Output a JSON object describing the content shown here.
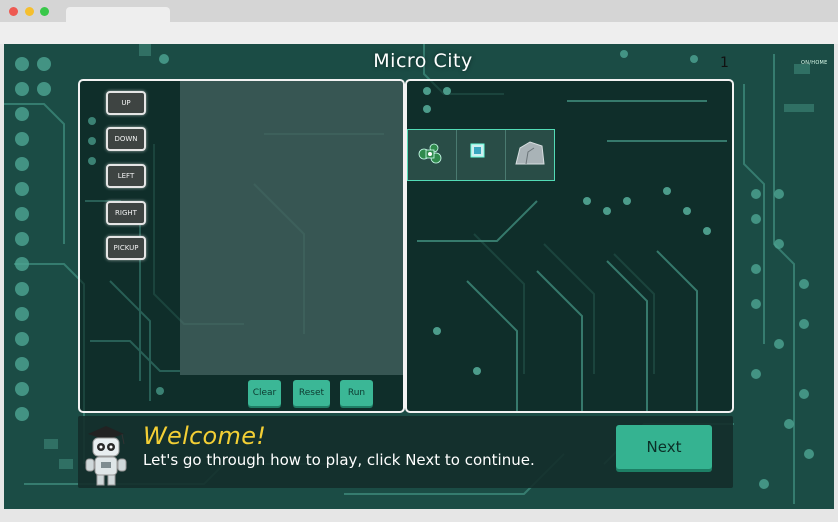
{
  "game": {
    "title": "Micro City",
    "level": "1",
    "tag": "ON/HOME",
    "commands": [
      "UP",
      "DOWN",
      "LEFT",
      "RIGHT",
      "PICKUP"
    ],
    "actions": {
      "clear": "Clear",
      "reset": "Reset",
      "run": "Run"
    }
  },
  "dialog": {
    "heading": "Welcome!",
    "message": "Let's go through how to play, click Next to continue.",
    "next_label": "Next"
  },
  "colors": {
    "accent": "#3bb796",
    "heading": "#f3cf35",
    "board": "#1b4c45"
  }
}
